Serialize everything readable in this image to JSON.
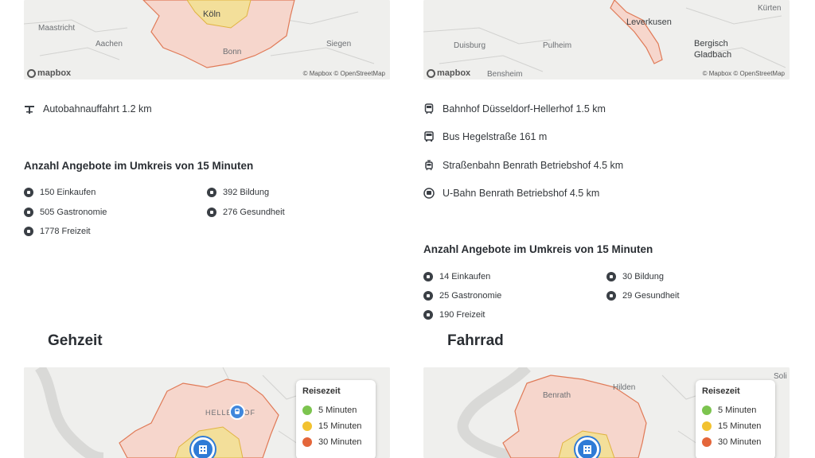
{
  "left_column": {
    "map_top": {
      "labels": [
        "Maastricht",
        "Aachen",
        "Köln",
        "Siegen",
        "Bonn"
      ],
      "mapbox_logo": "mapbox",
      "attribution": "© Mapbox © OpenStreetMap"
    },
    "transport": [
      {
        "icon": "highway-exit-icon",
        "text": "Autobahnauffahrt 1.2 km"
      }
    ],
    "offers_title": "Anzahl Angebote im Umkreis von 15 Minuten",
    "offers": [
      {
        "icon": "shopping-icon",
        "text": "150 Einkaufen"
      },
      {
        "icon": "education-icon",
        "text": "392 Bildung"
      },
      {
        "icon": "restaurant-icon",
        "text": "505 Gastronomie"
      },
      {
        "icon": "health-icon",
        "text": "276 Gesundheit"
      },
      {
        "icon": "leisure-icon",
        "text": "1778 Freizeit"
      }
    ],
    "heading": "Gehzeit",
    "map_bottom": {
      "label": "HELLERHOF"
    }
  },
  "right_column": {
    "map_top": {
      "labels": [
        "Leverkusen",
        "Bergisch Gladbach",
        "Duisburg",
        "Pulheim",
        "Bensheim",
        "Kürten"
      ],
      "mapbox_logo": "mapbox",
      "attribution": "© Mapbox © OpenStreetMap"
    },
    "transport": [
      {
        "icon": "train-icon",
        "text": "Bahnhof Düsseldorf-Hellerhof 1.5 km"
      },
      {
        "icon": "bus-icon",
        "text": "Bus Hegelstraße 161 m"
      },
      {
        "icon": "tram-icon",
        "text": "Straßenbahn Benrath Betriebshof 4.5 km"
      },
      {
        "icon": "subway-icon",
        "text": "U-Bahn Benrath Betriebshof 4.5 km"
      }
    ],
    "offers_title": "Anzahl Angebote im Umkreis von 15 Minuten",
    "offers": [
      {
        "icon": "shopping-icon",
        "text": "14 Einkaufen"
      },
      {
        "icon": "education-icon",
        "text": "30 Bildung"
      },
      {
        "icon": "restaurant-icon",
        "text": "25 Gastronomie"
      },
      {
        "icon": "health-icon",
        "text": "29 Gesundheit"
      },
      {
        "icon": "leisure-icon",
        "text": "190 Freizeit"
      }
    ],
    "heading": "Fahrrad",
    "map_bottom": {
      "labels": [
        "Benrath",
        "Hilden",
        "Soli"
      ]
    }
  },
  "legend": {
    "title": "Reisezeit",
    "items": [
      {
        "label": "5 Minuten",
        "color": "#7cc44f"
      },
      {
        "label": "15 Minuten",
        "color": "#f2c230"
      },
      {
        "label": "30 Minuten",
        "color": "#e4663a"
      }
    ]
  },
  "colors": {
    "isochrone_fill": "#f6d6cc",
    "isochrone_stroke": "#e07a57",
    "pin": "#2f7bd6"
  }
}
